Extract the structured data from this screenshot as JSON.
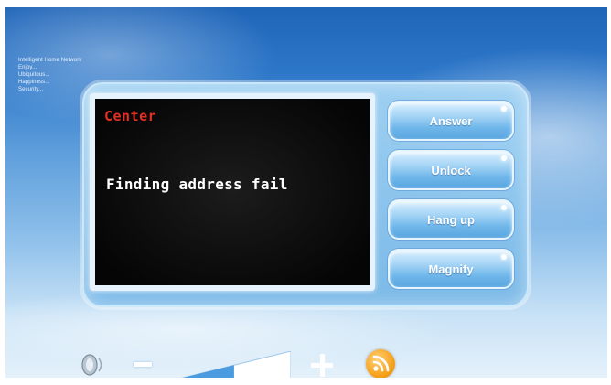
{
  "brand": {
    "lines": [
      "Intelligent Home Network",
      "Enjoy...",
      "Ubiquitous...",
      "Happiness...",
      "Security..."
    ]
  },
  "display": {
    "title": "Center",
    "message": "Finding address fail"
  },
  "buttons": {
    "answer": "Answer",
    "unlock": "Unlock",
    "hang_up": "Hang up",
    "magnify": "Magnify"
  },
  "volume": {
    "level": 0.55
  },
  "icons": {
    "speaker": "speaker-icon",
    "minus": "volume-down-icon",
    "plus": "volume-up-icon",
    "rss": "rss-icon"
  },
  "colors": {
    "title_red": "#e33024",
    "accent_orange": "#f6a21c",
    "button_blue": "#6eb6ea"
  }
}
